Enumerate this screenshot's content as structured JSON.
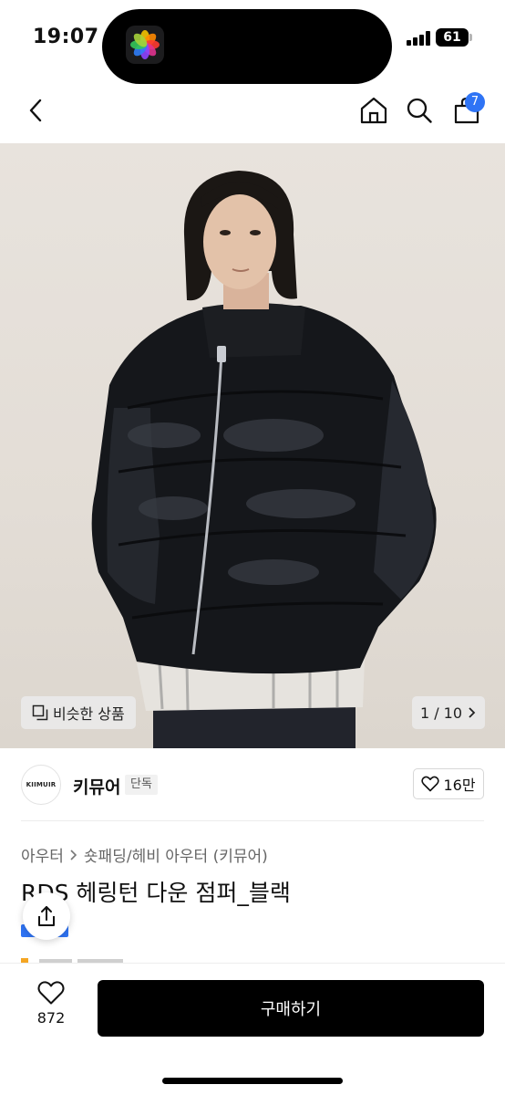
{
  "status_bar": {
    "time": "19:07",
    "battery": "61"
  },
  "nav": {
    "back_icon": "chevron-left-icon",
    "home_icon": "home-icon",
    "search_icon": "search-icon",
    "cart_icon": "bag-icon",
    "cart_count": "7"
  },
  "hero": {
    "similar_label": "비슷한 상품",
    "page_indicator": "1 / 10"
  },
  "brand": {
    "logo_text": "KIIMUIR",
    "name": "키뮤어",
    "tag": "단독",
    "like_count": "16만"
  },
  "breadcrumb": [
    "아우터",
    "숏패딩/헤비 아우터 (키뮤어)"
  ],
  "product": {
    "title": "RDS 헤링턴 다운 점퍼_블랙"
  },
  "bottom": {
    "wish_count": "872",
    "buy_label": "구매하기"
  },
  "colors": {
    "accent": "#2f74f5",
    "buy_button": "#000000"
  }
}
